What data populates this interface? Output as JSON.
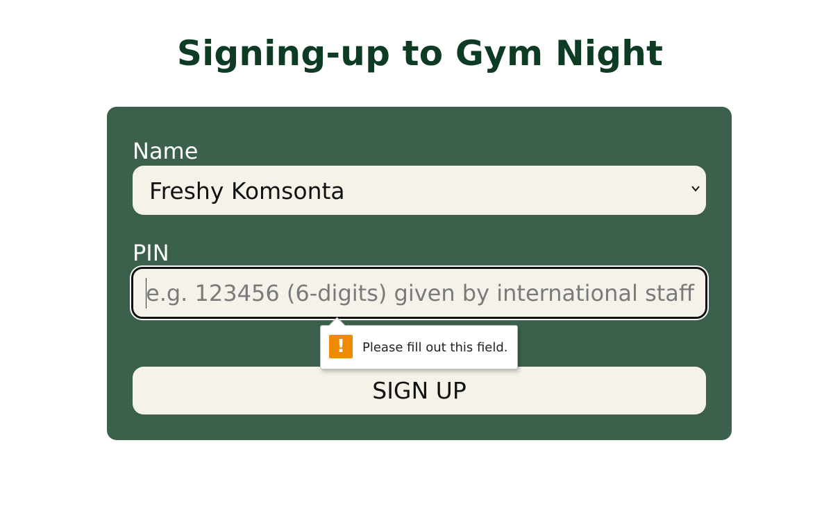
{
  "page": {
    "title": "Signing-up to Gym Night"
  },
  "form": {
    "name_label": "Name",
    "name_value": "Freshy Komsonta",
    "pin_label": "PIN",
    "pin_placeholder": "e.g. 123456 (6-digits) given by international staff",
    "pin_value": "",
    "submit_label": "SIGN UP"
  },
  "validation": {
    "message": "Please fill out this field.",
    "icon": "warning-icon",
    "icon_glyph": "!"
  },
  "colors": {
    "title": "#0d3b23",
    "card_background": "#3b614c",
    "field_background": "#f5f2ea",
    "warning": "#f08a00"
  }
}
